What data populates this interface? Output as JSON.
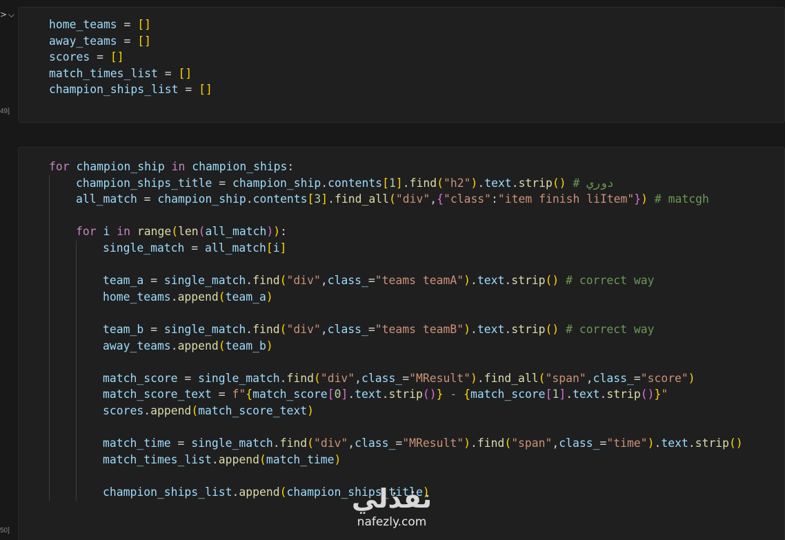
{
  "gutter": {
    "exec_count_1": "49]",
    "exec_count_2": "50]",
    "collapse_icon": "chevron-down-icon"
  },
  "cell1": {
    "lines": [
      [
        "home_teams",
        " = ",
        "[]"
      ],
      [
        "away_teams",
        " = ",
        "[]"
      ],
      [
        "scores",
        " = ",
        "[]"
      ],
      [
        "match_times_list",
        " = ",
        "[]"
      ],
      [
        "champion_ships_list",
        " = ",
        "[]"
      ]
    ]
  },
  "cell2": {
    "l1": [
      "for",
      " champion_ship ",
      "in",
      " champion_ships",
      ":"
    ],
    "l2": [
      "champion_ships_title",
      " = ",
      "champion_ship",
      ".",
      "contents",
      "[",
      "1",
      "]",
      ".",
      "find",
      "(",
      "\"h2\"",
      ")",
      ".",
      "text",
      ".",
      "strip",
      "()",
      " # دوري"
    ],
    "l3": [
      "all_match",
      " = ",
      "champion_ship",
      ".",
      "contents",
      "[",
      "3",
      "]",
      ".",
      "find_all",
      "(",
      "\"div\"",
      ",",
      "{",
      "\"class\"",
      ":",
      "\"item finish liItem\"",
      "}",
      ")",
      " # matcgh"
    ],
    "l5": [
      "for",
      " i ",
      "in",
      " ",
      "range",
      "(",
      "len",
      "(",
      "all_match",
      ")",
      ")",
      ":"
    ],
    "l6": [
      "single_match",
      " = ",
      "all_match",
      "[",
      "i",
      "]"
    ],
    "l8": [
      "team_a",
      " = ",
      "single_match",
      ".",
      "find",
      "(",
      "\"div\"",
      ",",
      "class_",
      "=",
      "\"teams teamA\"",
      ")",
      ".",
      "text",
      ".",
      "strip",
      "()",
      " # correct way"
    ],
    "l9": [
      "home_teams",
      ".",
      "append",
      "(",
      "team_a",
      ")"
    ],
    "l11": [
      "team_b",
      " = ",
      "single_match",
      ".",
      "find",
      "(",
      "\"div\"",
      ",",
      "class_",
      "=",
      "\"teams teamB\"",
      ")",
      ".",
      "text",
      ".",
      "strip",
      "()",
      " # correct way"
    ],
    "l12": [
      "away_teams",
      ".",
      "append",
      "(",
      "team_b",
      ")"
    ],
    "l14": [
      "match_score",
      " = ",
      "single_match",
      ".",
      "find",
      "(",
      "\"div\"",
      ",",
      "class_",
      "=",
      "\"MResult\"",
      ")",
      ".",
      "find_all",
      "(",
      "\"span\"",
      ",",
      "class_",
      "=",
      "\"score\"",
      ")"
    ],
    "l15": [
      "match_score_text",
      " = ",
      "f\"",
      "{",
      "match_score",
      "[",
      "0",
      "]",
      ".",
      "text",
      ".",
      "strip",
      "()",
      "}",
      " - ",
      "{",
      "match_score",
      "[",
      "1",
      "]",
      ".",
      "text",
      ".",
      "strip",
      "()",
      "}",
      "\""
    ],
    "l16": [
      "scores",
      ".",
      "append",
      "(",
      "match_score_text",
      ")"
    ],
    "l18": [
      "match_time",
      " = ",
      "single_match",
      ".",
      "find",
      "(",
      "\"div\"",
      ",",
      "class_",
      "=",
      "\"MResult\"",
      ")",
      ".",
      "find",
      "(",
      "\"span\"",
      ",",
      "class_",
      "=",
      "\"time\"",
      ")",
      ".",
      "text",
      ".",
      "strip",
      "()"
    ],
    "l19": [
      "match_times_list",
      ".",
      "append",
      "(",
      "match_time",
      ")"
    ],
    "l21": [
      "champion_ships_list",
      ".",
      "append",
      "(",
      "champion_ships_title",
      ")"
    ]
  },
  "watermark": {
    "arabic": "نفذلي",
    "latin": "nafezly.com"
  }
}
